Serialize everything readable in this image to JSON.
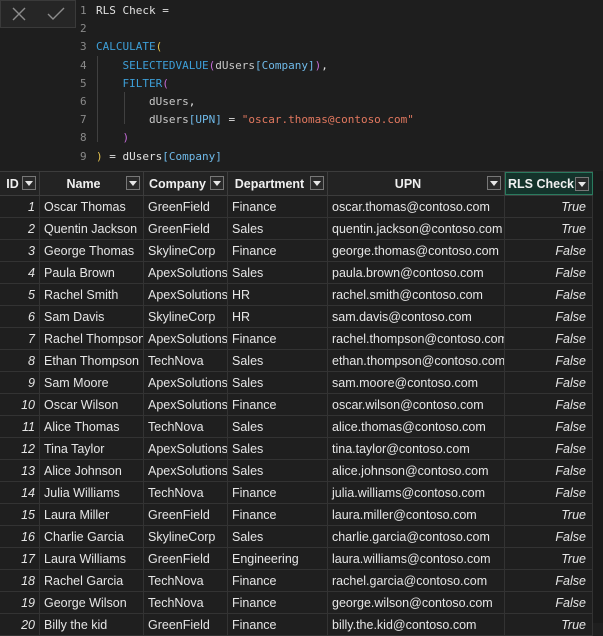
{
  "formula": {
    "lines": [
      {
        "n": "1"
      },
      {
        "n": "2"
      },
      {
        "n": "3"
      },
      {
        "n": "4"
      },
      {
        "n": "5"
      },
      {
        "n": "6"
      },
      {
        "n": "7"
      },
      {
        "n": "8"
      },
      {
        "n": "9"
      }
    ],
    "measure_name": "RLS Check =",
    "calculate": "CALCULATE",
    "selectedvalue": "SELECTEDVALUE",
    "filter": "FILTER",
    "table_dusers": "dUsers",
    "col_company": "[Company]",
    "col_upn": "[UPN]",
    "upn_value": "\"oscar.thomas@contoso.com\"",
    "open_paren": "(",
    "close_paren": ")",
    "comma": ",",
    "equals": " = ",
    "final_tail": " = dUsers",
    "final_col": "[Company]"
  },
  "table": {
    "headers": [
      "ID",
      "Name",
      "Company",
      "Department",
      "UPN",
      "RLS Check"
    ],
    "rows": [
      [
        "1",
        "Oscar Thomas",
        "GreenField",
        "Finance",
        "oscar.thomas@contoso.com",
        "True"
      ],
      [
        "2",
        "Quentin Jackson",
        "GreenField",
        "Sales",
        "quentin.jackson@contoso.com",
        "True"
      ],
      [
        "3",
        "George Thomas",
        "SkylineCorp",
        "Finance",
        "george.thomas@contoso.com",
        "False"
      ],
      [
        "4",
        "Paula Brown",
        "ApexSolutions",
        "Sales",
        "paula.brown@contoso.com",
        "False"
      ],
      [
        "5",
        "Rachel Smith",
        "ApexSolutions",
        "HR",
        "rachel.smith@contoso.com",
        "False"
      ],
      [
        "6",
        "Sam Davis",
        "SkylineCorp",
        "HR",
        "sam.davis@contoso.com",
        "False"
      ],
      [
        "7",
        "Rachel Thompson",
        "ApexSolutions",
        "Finance",
        "rachel.thompson@contoso.com",
        "False"
      ],
      [
        "8",
        "Ethan Thompson",
        "TechNova",
        "Sales",
        "ethan.thompson@contoso.com",
        "False"
      ],
      [
        "9",
        "Sam Moore",
        "ApexSolutions",
        "Sales",
        "sam.moore@contoso.com",
        "False"
      ],
      [
        "10",
        "Oscar Wilson",
        "ApexSolutions",
        "Finance",
        "oscar.wilson@contoso.com",
        "False"
      ],
      [
        "11",
        "Alice Thomas",
        "TechNova",
        "Sales",
        "alice.thomas@contoso.com",
        "False"
      ],
      [
        "12",
        "Tina Taylor",
        "ApexSolutions",
        "Sales",
        "tina.taylor@contoso.com",
        "False"
      ],
      [
        "13",
        "Alice Johnson",
        "ApexSolutions",
        "Sales",
        "alice.johnson@contoso.com",
        "False"
      ],
      [
        "14",
        "Julia Williams",
        "TechNova",
        "Finance",
        "julia.williams@contoso.com",
        "False"
      ],
      [
        "15",
        "Laura Miller",
        "GreenField",
        "Finance",
        "laura.miller@contoso.com",
        "True"
      ],
      [
        "16",
        "Charlie Garcia",
        "SkylineCorp",
        "Sales",
        "charlie.garcia@contoso.com",
        "False"
      ],
      [
        "17",
        "Laura Williams",
        "GreenField",
        "Engineering",
        "laura.williams@contoso.com",
        "True"
      ],
      [
        "18",
        "Rachel Garcia",
        "TechNova",
        "Finance",
        "rachel.garcia@contoso.com",
        "False"
      ],
      [
        "19",
        "George Wilson",
        "TechNova",
        "Finance",
        "george.wilson@contoso.com",
        "False"
      ],
      [
        "20",
        "Billy the kid",
        "GreenField",
        "Finance",
        "billy.the.kid@contoso.com",
        "True"
      ]
    ]
  },
  "icons": {
    "cancel": "close-icon",
    "commit": "checkmark-icon",
    "filter": "chevron-down-icon"
  }
}
